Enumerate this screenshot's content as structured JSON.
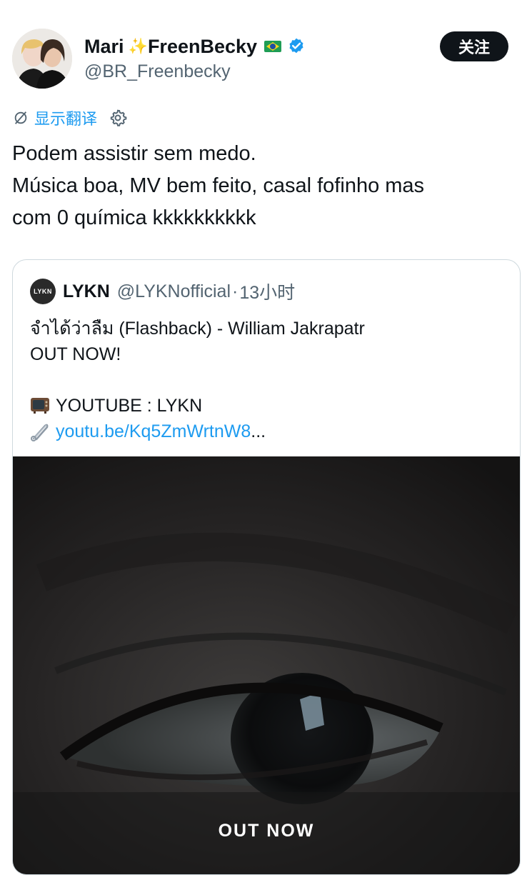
{
  "author": {
    "name_first": "Mari",
    "name_second": "FreenBecky",
    "handle": "@BR_Freenbecky",
    "avatar_icon": "two-people-avatar",
    "sparkle_icon": "sparkles-emoji",
    "flag_icon": "brazil-flag-emoji",
    "verified_icon": "verified-badge",
    "verified_color": "#1d9bf0"
  },
  "follow_button": {
    "label": "关注"
  },
  "translate": {
    "label": "显示翻译",
    "icon": "translate-off-icon",
    "settings_icon": "gear-icon",
    "link_color": "#1d9bf0"
  },
  "tweet": {
    "lines": [
      "Podem assistir sem medo.",
      "Música boa, MV bem feito, casal fofinho mas",
      "com 0 química kkkkkkkkkk"
    ]
  },
  "quote": {
    "avatar_text": "LYKN",
    "name": "LYKN",
    "handle": "@LYKNofficial",
    "separator": "·",
    "time": "13小时",
    "lines": [
      "จำได้ว่าลืม (Flashback) - William Jakrapatr",
      "OUT NOW!",
      "",
      "YOUTUBE : LYKN"
    ],
    "link_text": "youtu.be/Kq5ZmWrtnW8",
    "link_suffix": "...",
    "tv_icon": "television-emoji",
    "pin_icon": "safety-pin-emoji",
    "media": {
      "icon": "eye-closeup-image",
      "caption": "OUT NOW"
    }
  }
}
